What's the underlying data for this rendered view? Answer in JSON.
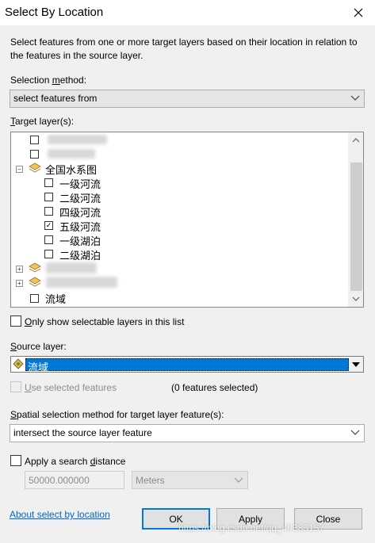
{
  "window": {
    "title": "Select By Location"
  },
  "description": "Select features from one or more target layers based on their location in relation to the features in the source layer.",
  "selection_method": {
    "label": "Selection method:",
    "value": "select features from"
  },
  "target_layers": {
    "label": "Target layer(s):",
    "items": {
      "group_label": "全国水系图",
      "child_1": "一级河流",
      "child_2": "二级河流",
      "child_3": "四级河流",
      "child_4": "五级河流",
      "child_5": "一级湖泊",
      "child_6": "二级湖泊",
      "last": "流域"
    },
    "checked": [
      "五级河流"
    ]
  },
  "only_selectable": {
    "label": "Only show selectable layers in this list",
    "checked": false
  },
  "source_layer": {
    "label": "Source layer:",
    "value": "流域",
    "use_selected_label": "Use selected features",
    "features_selected": "(0 features selected)"
  },
  "spatial_method": {
    "label": "Spatial selection method for target layer feature(s):",
    "value": "intersect the source layer feature"
  },
  "search_distance": {
    "label": "Apply a search distance",
    "checked": false,
    "value": "50000.000000",
    "units": "Meters"
  },
  "footer": {
    "about_link": "About select by location",
    "ok": "OK",
    "apply": "Apply",
    "close": "Close",
    "watermark": "https://blog.csdn.net/qq_40383157"
  },
  "colors": {
    "selection": "#0078d7",
    "link": "#0066cc",
    "default_border": "#0078d7"
  }
}
